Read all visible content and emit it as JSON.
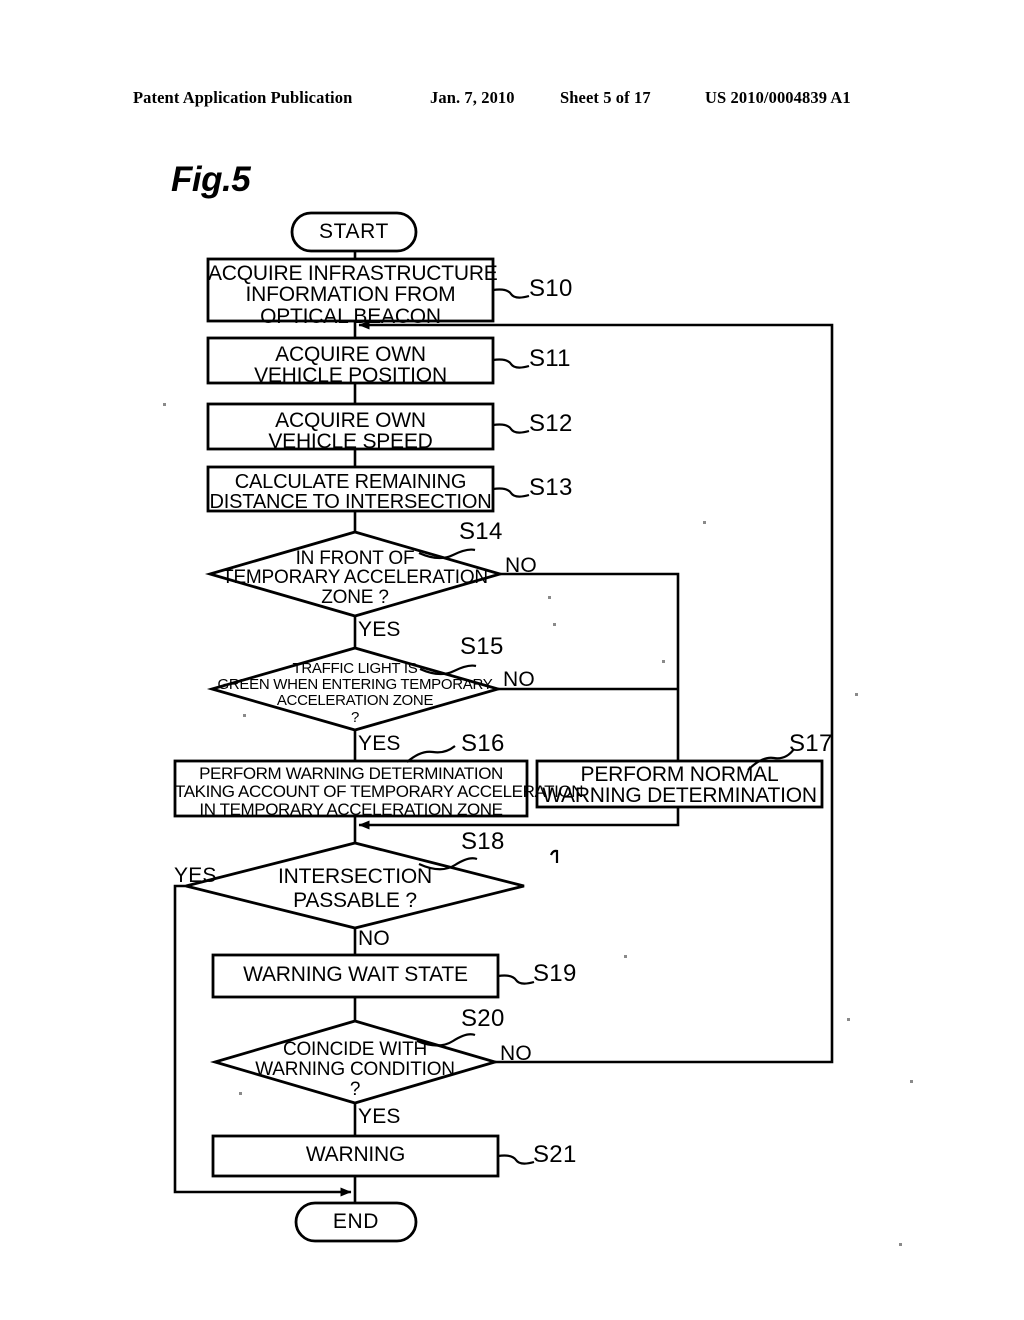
{
  "header": {
    "publication": "Patent Application Publication",
    "date": "Jan. 7, 2010",
    "sheet": "Sheet 5 of 17",
    "number": "US 2010/0004839 A1"
  },
  "figure": {
    "label": "Fig.5",
    "title": "Fig.5"
  },
  "nodes": {
    "start": {
      "id": "",
      "type": "terminal",
      "text": [
        "START"
      ]
    },
    "s10": {
      "id": "S10",
      "type": "process",
      "text": [
        "ACQUIRE INFRASTRUCTURE",
        "INFORMATION FROM",
        "OPTICAL BEACON"
      ]
    },
    "s11": {
      "id": "S11",
      "type": "process",
      "text": [
        "ACQUIRE OWN",
        "VEHICLE POSITION"
      ]
    },
    "s12": {
      "id": "S12",
      "type": "process",
      "text": [
        "ACQUIRE OWN",
        "VEHICLE SPEED"
      ]
    },
    "s13": {
      "id": "S13",
      "type": "process",
      "text": [
        "CALCULATE REMAINING",
        "DISTANCE TO INTERSECTION"
      ]
    },
    "s14": {
      "id": "S14",
      "type": "decision",
      "text": [
        "IN FRONT OF",
        "TEMPORARY ACCELERATION",
        "ZONE ?"
      ]
    },
    "s15": {
      "id": "S15",
      "type": "decision",
      "text": [
        "TRAFFIC LIGHT IS",
        "GREEN WHEN ENTERING TEMPORARY",
        "ACCELERATION ZONE",
        "?"
      ]
    },
    "s16": {
      "id": "S16",
      "type": "process",
      "text": [
        "PERFORM WARNING DETERMINATION",
        "TAKING ACCOUNT OF TEMPORARY ACCELERATION",
        "IN TEMPORARY ACCELERATION ZONE"
      ]
    },
    "s17": {
      "id": "S17",
      "type": "process",
      "text": [
        "PERFORM NORMAL",
        "WARNING DETERMINATION"
      ]
    },
    "s18": {
      "id": "S18",
      "type": "decision",
      "text": [
        "INTERSECTION",
        "PASSABLE ?"
      ]
    },
    "s19": {
      "id": "S19",
      "type": "process",
      "text": [
        "WARNING WAIT STATE"
      ]
    },
    "s20": {
      "id": "S20",
      "type": "decision",
      "text": [
        "COINCIDE WITH",
        "WARNING CONDITION",
        "?"
      ]
    },
    "s21": {
      "id": "S21",
      "type": "process",
      "text": [
        "WARNING"
      ]
    },
    "end": {
      "id": "",
      "type": "terminal",
      "text": [
        "END"
      ]
    }
  },
  "branch_labels": {
    "s14_no": "NO",
    "s14_yes": "YES",
    "s15_no": "NO",
    "s15_yes": "YES",
    "s18_yes": "YES",
    "s18_no": "NO",
    "s20_no": "NO",
    "s20_yes": "YES"
  },
  "step_ids": {
    "s10": "S10",
    "s11": "S11",
    "s12": "S12",
    "s13": "S13",
    "s14": "S14",
    "s15": "S15",
    "s16": "S16",
    "s17": "S17",
    "s18": "S18",
    "s19": "S19",
    "s20": "S20",
    "s21": "S21"
  },
  "colors": {
    "ink": "#000000",
    "paper": "#ffffff"
  }
}
